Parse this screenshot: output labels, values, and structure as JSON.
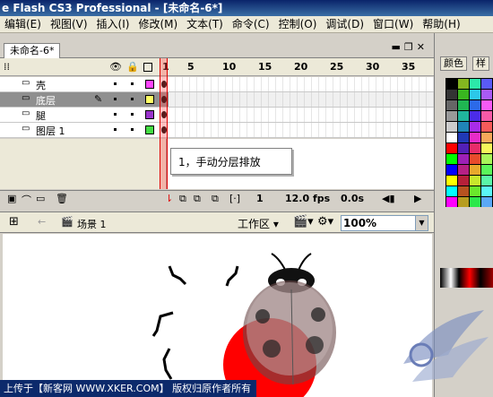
{
  "title": "e Flash CS3 Professional - [未命名-6*]",
  "menu": [
    "编辑(E)",
    "视图(V)",
    "插入(I)",
    "修改(M)",
    "文本(T)",
    "命令(C)",
    "控制(O)",
    "调试(D)",
    "窗口(W)",
    "帮助(H)"
  ],
  "doc_tab": "未命名-6*",
  "frame_numbers": [
    "1",
    "5",
    "10",
    "15",
    "20",
    "25",
    "30",
    "35"
  ],
  "layers": [
    {
      "name": "壳",
      "color": "#ff44ff",
      "selected": false
    },
    {
      "name": "底层",
      "color": "#ffff66",
      "selected": true
    },
    {
      "name": "腿",
      "color": "#9933cc",
      "selected": false
    },
    {
      "name": "图层 1",
      "color": "#44dd44",
      "selected": false
    }
  ],
  "tooltip": "1，手动分层排放",
  "status": {
    "frame": "1",
    "fps": "12.0 fps",
    "time": "0.0s"
  },
  "scene": "场景 1",
  "workspace": "工作区",
  "zoom": "100%",
  "footer": "上传于【新客网 WWW.XKER.COM】 版权归原作者所有",
  "right_tabs": [
    "颜色",
    "样"
  ],
  "colors": {
    "accent": "#0a246a",
    "selected_layer": "#8f8f8f",
    "playhead": "#e00000"
  }
}
